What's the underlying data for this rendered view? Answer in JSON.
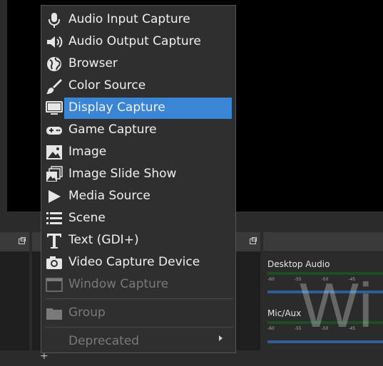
{
  "menu": {
    "items": [
      {
        "label": "Audio Input Capture",
        "icon": "microphone-icon"
      },
      {
        "label": "Audio Output Capture",
        "icon": "speaker-icon"
      },
      {
        "label": "Browser",
        "icon": "globe-icon"
      },
      {
        "label": "Color Source",
        "icon": "brush-icon"
      },
      {
        "label": "Display Capture",
        "icon": "monitor-icon",
        "selected": true
      },
      {
        "label": "Game Capture",
        "icon": "gamepad-icon"
      },
      {
        "label": "Image",
        "icon": "image-icon"
      },
      {
        "label": "Image Slide Show",
        "icon": "slideshow-icon"
      },
      {
        "label": "Media Source",
        "icon": "play-icon"
      },
      {
        "label": "Scene",
        "icon": "list-icon"
      },
      {
        "label": "Text (GDI+)",
        "icon": "text-icon"
      },
      {
        "label": "Video Capture Device",
        "icon": "camera-icon"
      },
      {
        "label": "Window Capture",
        "icon": "window-icon",
        "disabled": true
      }
    ],
    "group": {
      "label": "Group",
      "icon": "folder-icon",
      "disabled": true
    },
    "deprecated": {
      "label": "Deprecated",
      "icon": "submenu-arrow-icon",
      "disabled": true
    }
  },
  "mixer": {
    "desktop_audio": "Desktop Audio",
    "mic_aux": "Mic/Aux",
    "ticks": [
      "-60",
      "-55",
      "-50",
      "-45"
    ]
  },
  "watermark": "Wi",
  "colors": {
    "highlight": "#3a86d4",
    "menu_bg": "#2f2f2f",
    "meter_green": "#3b9b3f",
    "meter_blue": "#2c5f97"
  }
}
